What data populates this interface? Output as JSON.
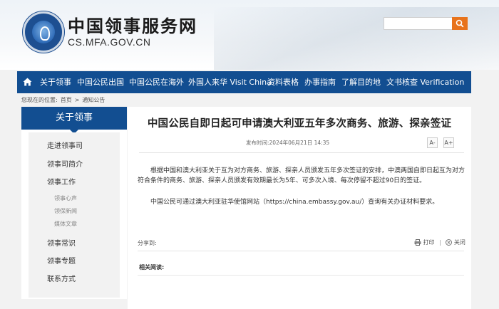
{
  "header": {
    "site_title": "中国领事服务网",
    "site_url": "CS.MFA.GOV.CN",
    "search": {
      "placeholder": "",
      "icon": "search-icon"
    }
  },
  "nav": {
    "items": [
      "关于领事",
      "中国公民出国",
      "中国公民在海外",
      "外国人来华 Visit China",
      "资料表格",
      "办事指南",
      "了解目的地",
      "文书核查 Verification"
    ]
  },
  "breadcrumb": {
    "prefix": "您现在的位置:",
    "home": "首页",
    "sep": ">",
    "current": "通知公告"
  },
  "sidebar": {
    "title": "关于领事",
    "items": [
      "走进领事司",
      "领事司简介",
      "领事工作"
    ],
    "subitems": [
      "领事心声",
      "领保新闻",
      "媒体文章"
    ],
    "items_bottom": [
      "领事常识",
      "领事专题",
      "联系方式"
    ]
  },
  "article": {
    "title": "中国公民自即日起可申请澳大利亚五年多次商务、旅游、探亲签证",
    "meta": "发布时间:2024年06月21日 14:35",
    "font_smaller": "A-",
    "font_larger": "A+",
    "paragraph1": "根据中国和澳大利亚关于互为对方商务、旅游、探亲人员颁发五年多次签证的安排，中澳两国自即日起互为对方符合条件的商务、旅游、探亲人员颁发有效期最长为5年、可多次入境、每次停留不超过90日的签证。",
    "paragraph2": "中国公民可通过澳大利亚驻华使馆网站（https://china.embassy.gov.au/）查询有关办证材料要求。",
    "share_label": "分享到:",
    "print_label": "打印",
    "close_label": "关闭",
    "related_label": "相关阅读:"
  },
  "colors": {
    "nav_bg": "#124e91",
    "accent": "#e8731c"
  }
}
